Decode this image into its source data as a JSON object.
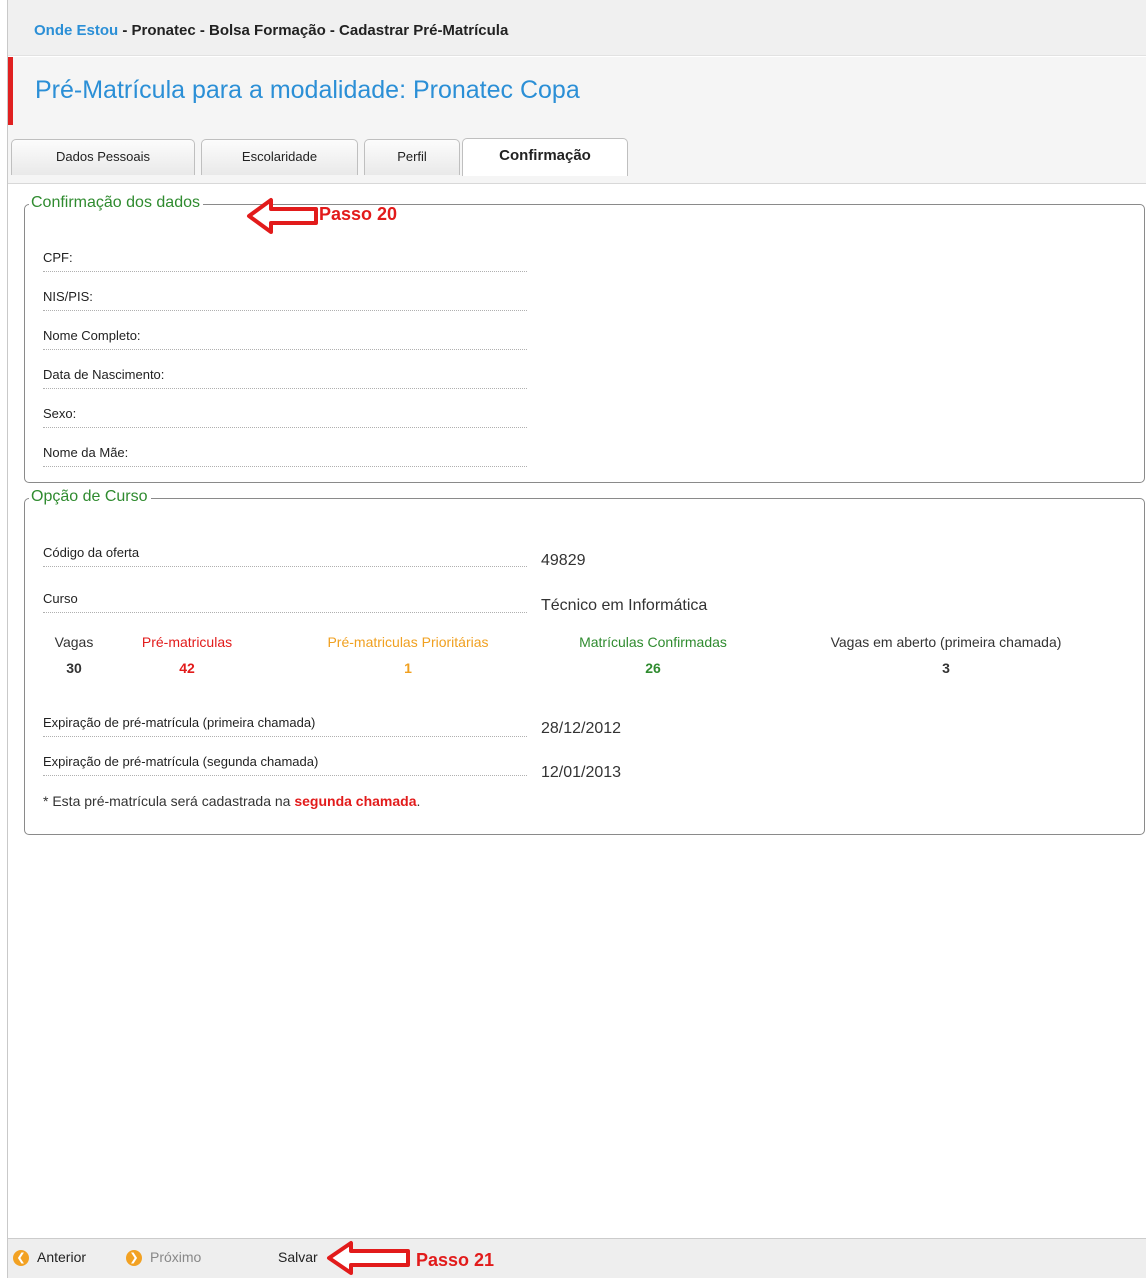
{
  "breadcrumb": {
    "here": "Onde Estou",
    "path": " - Pronatec - Bolsa Formação - Cadastrar Pré-Matrícula"
  },
  "page_title": "Pré-Matrícula para a modalidade: Pronatec Copa",
  "tabs": [
    {
      "label": "Dados Pessoais",
      "active": false
    },
    {
      "label": "Escolaridade",
      "active": false
    },
    {
      "label": "Perfil",
      "active": false
    },
    {
      "label": "Confirmação",
      "active": true
    }
  ],
  "confirmacao": {
    "legend": "Confirmação dos dados",
    "fields": [
      {
        "label": "CPF:"
      },
      {
        "label": "NIS/PIS:"
      },
      {
        "label": "Nome Completo:"
      },
      {
        "label": "Data de Nascimento:"
      },
      {
        "label": "Sexo:"
      },
      {
        "label": "Nome da Mãe:"
      }
    ]
  },
  "curso": {
    "legend": "Opção de Curso",
    "codigo_label": "Código da oferta",
    "codigo_value": "49829",
    "curso_label": "Curso",
    "curso_value": "Técnico em Informática",
    "stats": [
      {
        "header": "Vagas",
        "value": "30",
        "color": "#333333"
      },
      {
        "header": "Pré-matriculas",
        "value": "42",
        "color": "#e21b1b"
      },
      {
        "header": "Pré-matriculas Prioritárias",
        "value": "1",
        "color": "#f0a020"
      },
      {
        "header": "Matrículas Confirmadas",
        "value": "26",
        "color": "#2f8b2f"
      },
      {
        "header": "Vagas em aberto (primeira chamada)",
        "value": "3",
        "color": "#333333"
      }
    ],
    "exp1_label": "Expiração de pré-matrícula (primeira chamada)",
    "exp1_value": "28/12/2012",
    "exp2_label": "Expiração de pré-matrícula (segunda chamada)",
    "exp2_value": "12/01/2013",
    "note_prefix": "* Esta pré-matrícula será cadastrada na ",
    "note_highlight": "segunda chamada",
    "note_suffix": "."
  },
  "annotations": {
    "step20": "Passo 20",
    "step21": "Passo 21"
  },
  "footer": {
    "anterior": "Anterior",
    "proximo": "Próximo",
    "salvar": "Salvar"
  },
  "colors": {
    "accent_blue": "#2b8fd6",
    "legend_green": "#2f8b2f",
    "annotation_red": "#e21b1b",
    "nav_orange": "#f2a122"
  },
  "icons": {
    "anterior": "arrow-left-circle-icon",
    "proximo": "arrow-right-circle-icon",
    "annotation": "red-arrow-icon"
  }
}
